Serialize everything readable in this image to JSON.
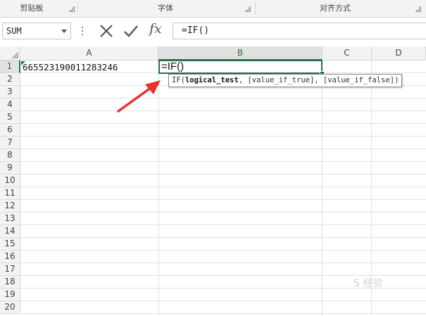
{
  "ribbon": {
    "groups": [
      {
        "label": "剪贴板"
      },
      {
        "label": "字体"
      },
      {
        "label": "对齐方式"
      }
    ]
  },
  "formula_bar": {
    "name_box": "SUM",
    "cancel_icon": "x-icon",
    "enter_icon": "check-icon",
    "fx_label": "fx",
    "formula": "=IF()"
  },
  "columns": [
    "A",
    "B",
    "C",
    "D"
  ],
  "rows": [
    "1",
    "2",
    "3",
    "4",
    "5",
    "6",
    "7",
    "8",
    "9",
    "10",
    "11",
    "12",
    "13",
    "14",
    "15",
    "16",
    "17",
    "18",
    "19",
    "20"
  ],
  "cells": {
    "A1": "665523190011283246",
    "B1": "=IF()"
  },
  "tooltip": {
    "func": "IF(",
    "arg1": "logical_test",
    "rest": ", [value_if_true], [value_if_false])"
  },
  "colors": {
    "selection": "#217346",
    "arrow": "#e8312a"
  },
  "watermark": "S 经验"
}
